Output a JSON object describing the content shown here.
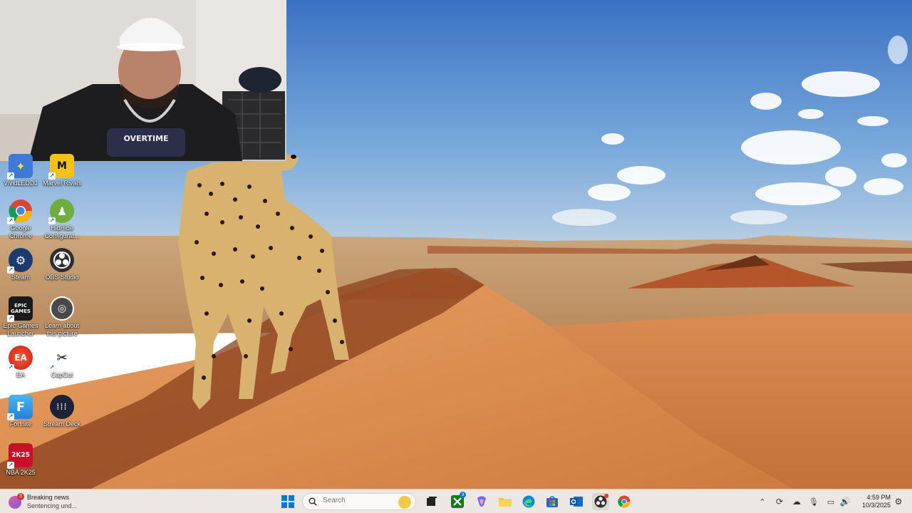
{
  "desktop": {
    "icons": [
      {
        "label": "VividLEDDJ",
        "icon": "vividled-icon"
      },
      {
        "label": "Marvel Rivals",
        "icon": "marvel-rivals-icon"
      },
      {
        "label": "Google Chrome",
        "icon": "chrome-icon"
      },
      {
        "label": "HidHide Configurat...",
        "icon": "hidhide-icon"
      },
      {
        "label": "Steam",
        "icon": "steam-icon"
      },
      {
        "label": "OBS Studio",
        "icon": "obs-icon"
      },
      {
        "label": "Epic Games Launcher",
        "icon": "epic-games-icon",
        "badge_text": "EPIC GAMES"
      },
      {
        "label": "Learn about this picture",
        "icon": "camera-icon"
      },
      {
        "label": "EA",
        "icon": "ea-icon",
        "badge_text": "EA"
      },
      {
        "label": "CapCut",
        "icon": "capcut-icon"
      },
      {
        "label": "Fortnite",
        "icon": "fortnite-icon",
        "badge_text": "F"
      },
      {
        "label": "Stream Deck",
        "icon": "stream-deck-icon"
      },
      {
        "label": "NBA 2K25",
        "icon": "nba2k-icon",
        "badge_text": "2K25"
      }
    ]
  },
  "webcam": {
    "shirt_text": "OVERTIME"
  },
  "taskbar": {
    "news": {
      "badge": "3",
      "title": "Breaking news",
      "subtitle": "Sentencing und..."
    },
    "search": {
      "placeholder": "Search"
    },
    "pinned": [
      {
        "icon": "windows-start-icon"
      },
      {
        "icon": "task-view-icon"
      },
      {
        "icon": "xbox-icon",
        "badge": "3"
      },
      {
        "icon": "copilot-icon"
      },
      {
        "icon": "file-explorer-icon"
      },
      {
        "icon": "edge-icon"
      },
      {
        "icon": "microsoft-store-icon"
      },
      {
        "icon": "outlook-icon"
      },
      {
        "icon": "obs-taskbar-icon"
      },
      {
        "icon": "chrome-taskbar-icon"
      }
    ],
    "tray": [
      "chevron-up-icon",
      "sync-icon",
      "onedrive-icon",
      "microphone-icon",
      "display-icon",
      "volume-icon"
    ],
    "clock": {
      "time": "4:59 PM",
      "date": "10/3/2025"
    }
  },
  "colors": {
    "taskbar_bg": "#ece7e3",
    "sky_top": "#3f78c6",
    "sand": "#d98a4a",
    "accent": "#0078d4"
  }
}
